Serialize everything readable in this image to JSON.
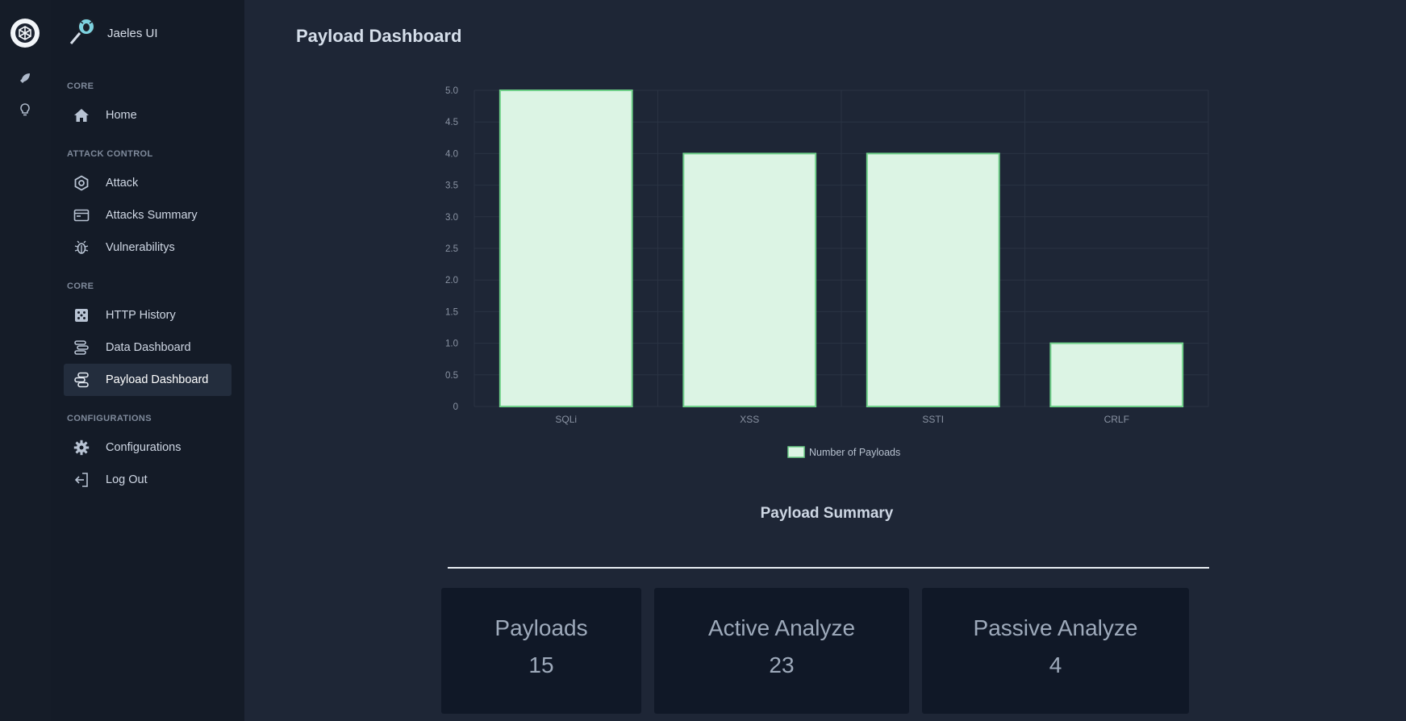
{
  "app": {
    "name": "Jaeles UI"
  },
  "rail": {
    "icons": [
      "app-logo-icon",
      "rocket-icon",
      "lightbulb-icon"
    ]
  },
  "sidebar": {
    "sections": [
      {
        "label": "CORE",
        "items": [
          {
            "label": "Home",
            "icon": "home-icon"
          }
        ]
      },
      {
        "label": "ATTACK CONTROL",
        "items": [
          {
            "label": "Attack",
            "icon": "hexagon-icon"
          },
          {
            "label": "Attacks Summary",
            "icon": "browser-window-icon"
          },
          {
            "label": "Vulnerabilitys",
            "icon": "bug-icon"
          }
        ]
      },
      {
        "label": "CORE",
        "items": [
          {
            "label": "HTTP History",
            "icon": "dice-icon"
          },
          {
            "label": "Data Dashboard",
            "icon": "stack-icon"
          },
          {
            "label": "Payload Dashboard",
            "icon": "route-icon",
            "active": true
          }
        ]
      },
      {
        "label": "CONFIGURATIONS",
        "items": [
          {
            "label": "Configurations",
            "icon": "gear-icon"
          },
          {
            "label": "Log Out",
            "icon": "logout-icon"
          }
        ]
      }
    ]
  },
  "main": {
    "title": "Payload Dashboard",
    "summary_title": "Payload Summary",
    "cards": [
      {
        "label": "Payloads",
        "value": "15"
      },
      {
        "label": "Active Analyze",
        "value": "23"
      },
      {
        "label": "Passive Analyze",
        "value": "4"
      }
    ]
  },
  "colors": {
    "bar_fill": "#dcf4e4",
    "bar_stroke": "#6fd089",
    "grid": "#2a3343",
    "tick": "#8a93a3"
  },
  "chart_data": {
    "type": "bar",
    "categories": [
      "SQLi",
      "XSS",
      "SSTI",
      "CRLF"
    ],
    "series": [
      {
        "name": "Number of Payloads",
        "values": [
          5,
          4,
          4,
          1
        ]
      }
    ],
    "ylim": [
      0,
      5
    ],
    "yticks": [
      "0",
      "0.5",
      "1.0",
      "1.5",
      "2.0",
      "2.5",
      "3.0",
      "3.5",
      "4.0",
      "4.5",
      "5.0"
    ],
    "grid": true,
    "legend": "bottom"
  }
}
